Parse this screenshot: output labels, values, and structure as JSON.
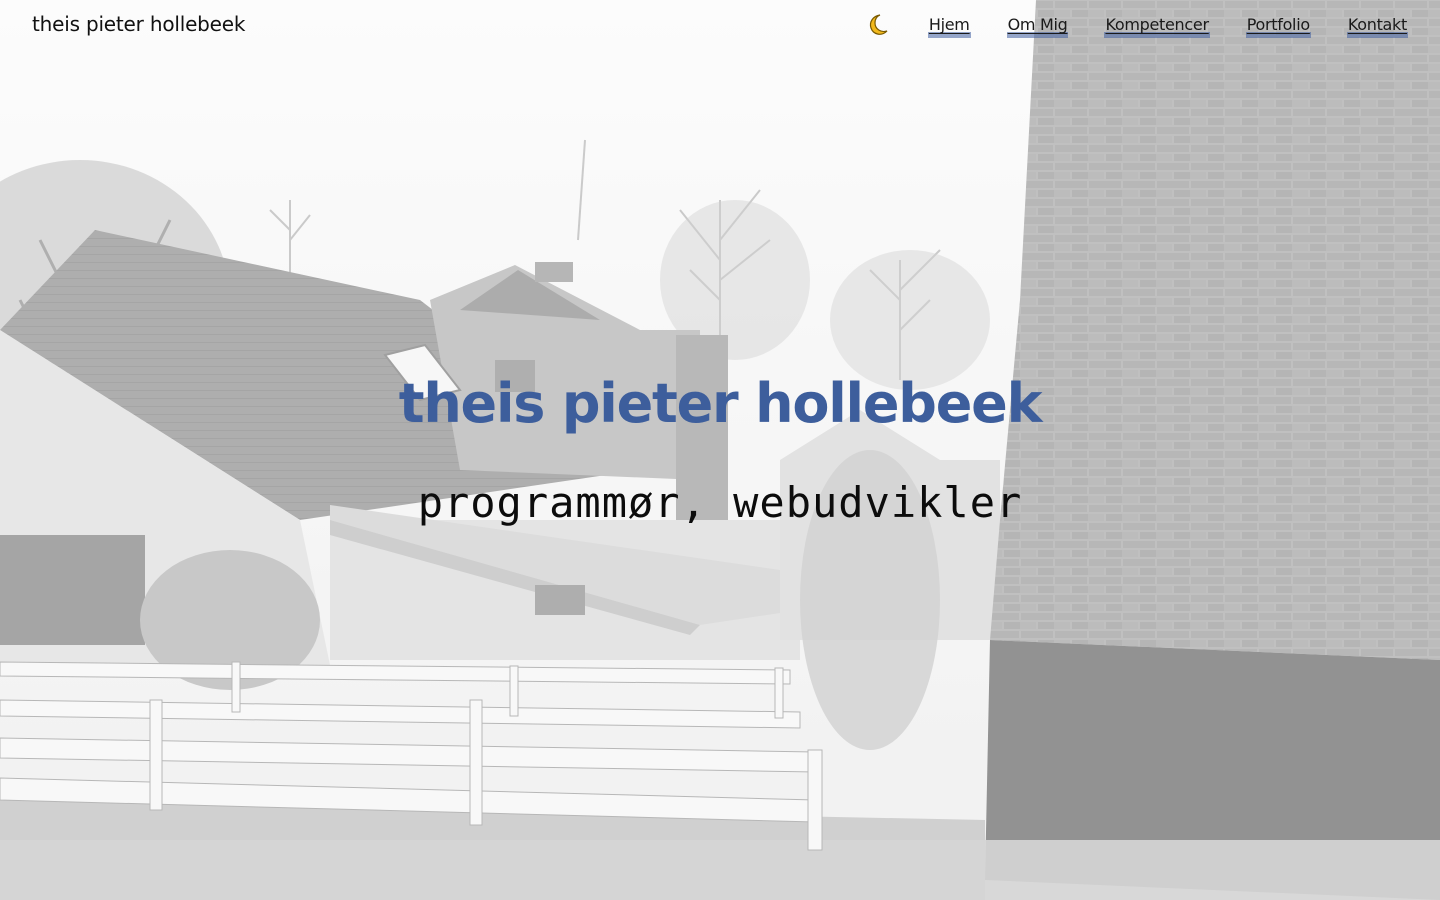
{
  "header": {
    "brand": "theis pieter hollebeek",
    "theme_toggle_icon": "moon-icon",
    "nav": [
      {
        "label": "Hjem"
      },
      {
        "label": "Om Mig"
      },
      {
        "label": "Kompetencer"
      },
      {
        "label": "Portfolio"
      },
      {
        "label": "Kontakt"
      }
    ]
  },
  "hero": {
    "title": "theis pieter hollebeek",
    "subtitle": "programmør, webudvikler",
    "background": "grayscale-house-photo"
  },
  "colors": {
    "accent": "#3d5e9c",
    "moon": "#f2b91c",
    "nav_underline": "#6b86bb"
  }
}
